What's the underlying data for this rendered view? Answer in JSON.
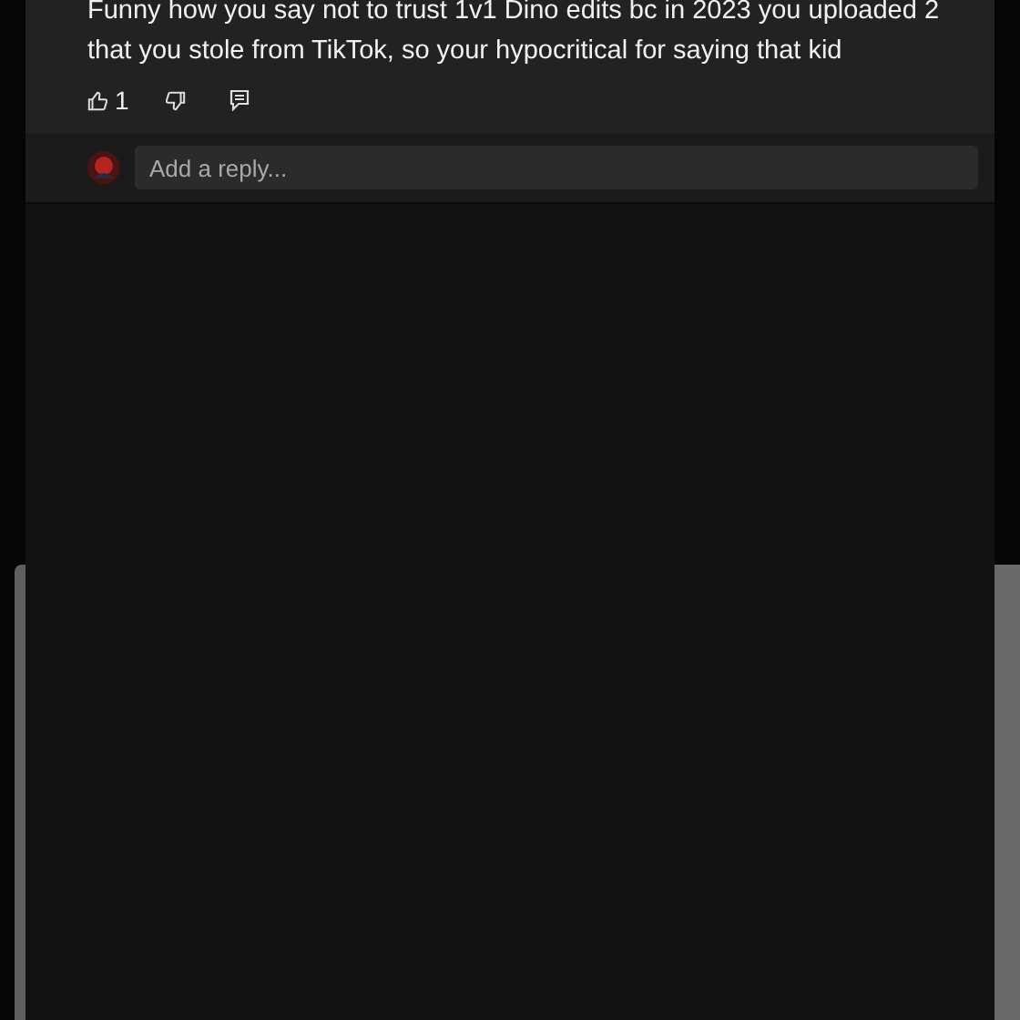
{
  "comment": {
    "text": "Funny how you say not to trust 1v1 Dino edits bc in 2023 you uploaded 2 that you stole from TikTok, so your hypocritical for saying that kid",
    "likes": "1"
  },
  "reply": {
    "placeholder": "Add a reply..."
  }
}
